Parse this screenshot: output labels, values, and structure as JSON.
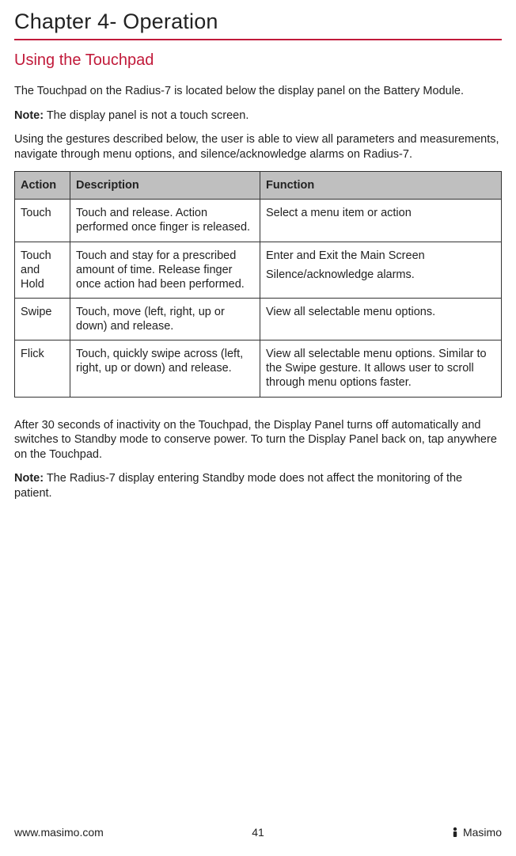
{
  "chapter_title": "Chapter 4- Operation",
  "section_title": "Using the Touchpad",
  "intro_line": "The Touchpad on the Radius-7 is located below the display panel on the Battery Module.",
  "note1_label": "Note:",
  "note1_text": " The display panel is not a touch screen.",
  "gesture_intro": "Using the gestures described below, the user is able to view all parameters and measurements, navigate through menu options, and silence/acknowledge alarms on Radius-7.",
  "table": {
    "headers": {
      "action": "Action",
      "description": "Description",
      "function": "Function"
    },
    "rows": [
      {
        "action": "Touch",
        "description": "Touch and release. Action performed once finger is released.",
        "function": [
          "Select a menu item or action"
        ]
      },
      {
        "action": "Touch and Hold",
        "description": "Touch and stay for a prescribed amount of time. Release finger once action had been performed.",
        "function": [
          "Enter and Exit the Main Screen",
          "Silence/acknowledge alarms."
        ]
      },
      {
        "action": "Swipe",
        "description": "Touch, move (left, right, up or down) and release.",
        "function": [
          "View all selectable menu options."
        ]
      },
      {
        "action": "Flick",
        "description": "Touch, quickly swipe across (left, right, up   or down) and release.",
        "function": [
          "View all selectable menu options. Similar to the Swipe gesture. It allows user to scroll through menu options faster."
        ]
      }
    ]
  },
  "standby_text": "After 30 seconds of inactivity on the Touchpad, the Display Panel turns off automatically and switches to Standby mode to conserve power. To turn the Display Panel back on, tap anywhere on the Touchpad.",
  "note2_label": "Note:",
  "note2_text": " The Radius-7 display entering Standby mode does not affect the monitoring of the patient.",
  "footer": {
    "url": "www.masimo.com",
    "page": "41",
    "brand": "Masimo"
  }
}
